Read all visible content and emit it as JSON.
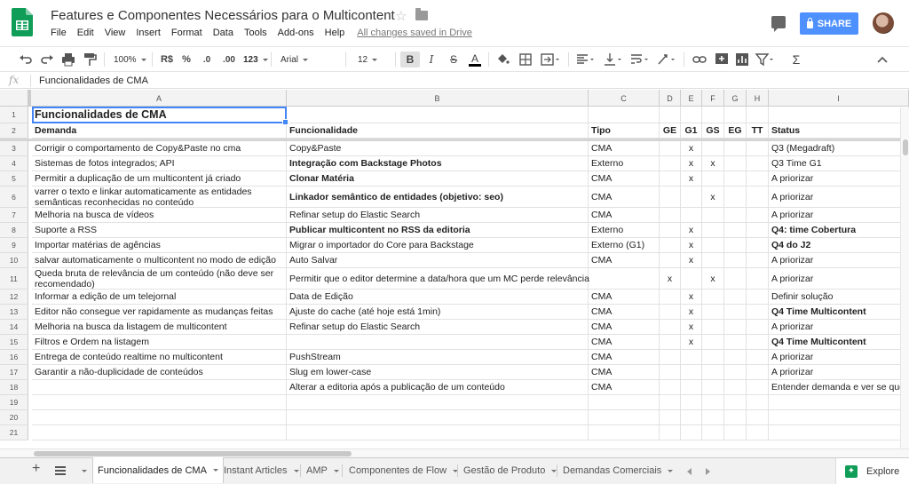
{
  "header": {
    "title": "Features e Componentes Necessários para o Multicontent",
    "menus": [
      "File",
      "Edit",
      "View",
      "Insert",
      "Format",
      "Data",
      "Tools",
      "Add-ons",
      "Help"
    ],
    "save_status": "All changes saved in Drive",
    "share_label": "SHARE"
  },
  "toolbar": {
    "zoom": "100%",
    "currency": "R$",
    "percent": "%",
    "decrease_decimals": ".0",
    "increase_decimals": ".00",
    "more_formats": "123",
    "font": "Arial",
    "font_size": "12",
    "bold": "B",
    "italic": "I",
    "strikethrough": "S",
    "text_color": "A"
  },
  "formula_bar": {
    "fx": "fx",
    "value": "Funcionalidades de CMA"
  },
  "columns": [
    "A",
    "B",
    "C",
    "D",
    "E",
    "F",
    "G",
    "H",
    "I"
  ],
  "rows": [
    {
      "n": "1",
      "a": "Funcionalidades de CMA",
      "b": "",
      "c": "",
      "d": "",
      "e": "",
      "f": "",
      "g": "",
      "h": "",
      "i": ""
    },
    {
      "n": "2",
      "a": "Demanda",
      "b": "Funcionalidade",
      "c": "Tipo",
      "d": "GE",
      "e": "G1",
      "f": "GS",
      "g": "EG",
      "h": "TT",
      "i": "Status"
    },
    {
      "n": "3",
      "a": "Corrigir o comportamento de Copy&Paste no cma",
      "b": "Copy&Paste",
      "c": "CMA",
      "d": "",
      "e": "x",
      "f": "",
      "g": "",
      "h": "",
      "i": "Q3 (Megadraft)"
    },
    {
      "n": "4",
      "a": "Sistemas de fotos integrados; API",
      "b": "Integração com Backstage Photos",
      "c": "Externo",
      "d": "",
      "e": "x",
      "f": "x",
      "g": "",
      "h": "",
      "i": "Q3 Time G1"
    },
    {
      "n": "5",
      "a": "Permitir a duplicação de um multicontent já criado",
      "b": "Clonar Matéria",
      "c": "CMA",
      "d": "",
      "e": "x",
      "f": "",
      "g": "",
      "h": "",
      "i": "A priorizar"
    },
    {
      "n": "6",
      "a": "varrer o texto e linkar automaticamente as entidades semânticas reconhecidas no conteúdo",
      "b": "Linkador semântico de entidades (objetivo: seo)",
      "c": "CMA",
      "d": "",
      "e": "",
      "f": "x",
      "g": "",
      "h": "",
      "i": "A priorizar"
    },
    {
      "n": "7",
      "a": "Melhoria na busca de vídeos",
      "b": "Refinar setup do Elastic Search",
      "c": "CMA",
      "d": "",
      "e": "",
      "f": "",
      "g": "",
      "h": "",
      "i": "A priorizar"
    },
    {
      "n": "8",
      "a": "Suporte a RSS",
      "b": "Publicar multicontent no RSS da editoria",
      "c": "Externo",
      "d": "",
      "e": "x",
      "f": "",
      "g": "",
      "h": "",
      "i": "Q4: time Cobertura"
    },
    {
      "n": "9",
      "a": "Importar matérias de agências",
      "b": "Migrar o importador do Core para Backstage",
      "c": "Externo (G1)",
      "d": "",
      "e": "x",
      "f": "",
      "g": "",
      "h": "",
      "i": "Q4 do J2"
    },
    {
      "n": "10",
      "a": "salvar automaticamente o multicontent no modo de edição",
      "b": "Auto Salvar",
      "c": "CMA",
      "d": "",
      "e": "x",
      "f": "",
      "g": "",
      "h": "",
      "i": "A priorizar"
    },
    {
      "n": "11",
      "a": "Queda bruta de relevância de um conteúdo (não deve ser recomendado)",
      "b": "Permitir que o editor determine a data/hora que um MC perde relevância",
      "c": "",
      "d": "x",
      "e": "",
      "f": "x",
      "g": "",
      "h": "",
      "i": "A priorizar"
    },
    {
      "n": "12",
      "a": "Informar a edição de um telejornal",
      "b": "Data de Edição",
      "c": "CMA",
      "d": "",
      "e": "x",
      "f": "",
      "g": "",
      "h": "",
      "i": "Definir solução"
    },
    {
      "n": "13",
      "a": "Editor não consegue ver rapidamente as mudanças feitas",
      "b": "Ajuste do cache (até hoje está 1min)",
      "c": "CMA",
      "d": "",
      "e": "x",
      "f": "",
      "g": "",
      "h": "",
      "i": "Q4 Time Multicontent"
    },
    {
      "n": "14",
      "a": "Melhoria na busca da listagem de multicontent",
      "b": "Refinar setup do Elastic Search",
      "c": "CMA",
      "d": "",
      "e": "x",
      "f": "",
      "g": "",
      "h": "",
      "i": "A priorizar"
    },
    {
      "n": "15",
      "a": "Filtros e Ordem na listagem",
      "b": "",
      "c": "CMA",
      "d": "",
      "e": "x",
      "f": "",
      "g": "",
      "h": "",
      "i": "Q4 Time Multicontent"
    },
    {
      "n": "16",
      "a": "Entrega de conteúdo realtime no multicontent",
      "b": "PushStream",
      "c": "CMA",
      "d": "",
      "e": "",
      "f": "",
      "g": "",
      "h": "",
      "i": "A priorizar"
    },
    {
      "n": "17",
      "a": "Garantir a não-duplicidade de conteúdos",
      "b": "Slug em lower-case",
      "c": "CMA",
      "d": "",
      "e": "",
      "f": "",
      "g": "",
      "h": "",
      "i": "A priorizar"
    },
    {
      "n": "18",
      "a": "",
      "b": "Alterar a editoria após a publicação de um conteúdo",
      "c": "CMA",
      "d": "",
      "e": "",
      "f": "",
      "g": "",
      "h": "",
      "i": "Entender demanda e ver se que"
    },
    {
      "n": "19",
      "a": "",
      "b": "",
      "c": "",
      "d": "",
      "e": "",
      "f": "",
      "g": "",
      "h": "",
      "i": ""
    },
    {
      "n": "20",
      "a": "",
      "b": "",
      "c": "",
      "d": "",
      "e": "",
      "f": "",
      "g": "",
      "h": "",
      "i": ""
    },
    {
      "n": "21",
      "a": "",
      "b": "",
      "c": "",
      "d": "",
      "e": "",
      "f": "",
      "g": "",
      "h": "",
      "i": ""
    }
  ],
  "sheet_tabs": [
    "Funcionalidades de CMA",
    "Instant Articles",
    "AMP",
    "Componentes de Flow",
    "Gestão de Produto",
    "Demandas Comerciais"
  ],
  "explore_label": "Explore"
}
